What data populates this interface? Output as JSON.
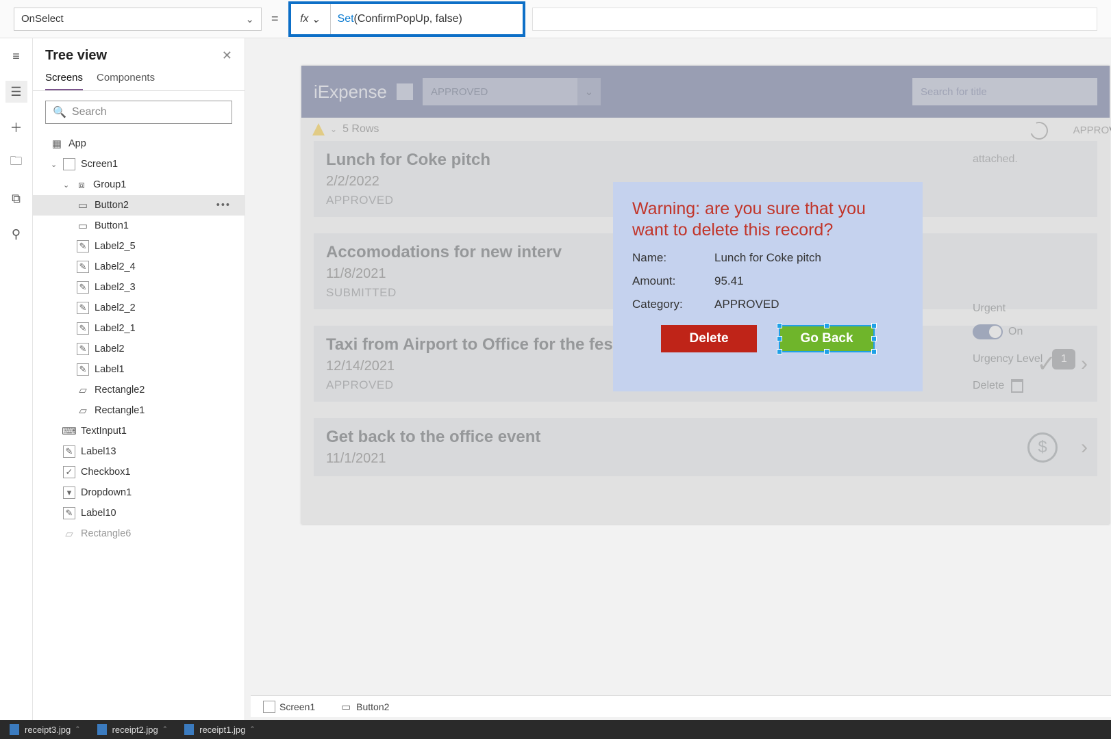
{
  "formula_bar": {
    "property": "OnSelect",
    "fx_label": "fx",
    "formula_kw": "Set",
    "formula_rest": "(ConfirmPopUp, false)"
  },
  "tree": {
    "title": "Tree view",
    "tabs": {
      "screens": "Screens",
      "components": "Components"
    },
    "search_placeholder": "Search",
    "nodes": {
      "app": "App",
      "screen1": "Screen1",
      "group1": "Group1",
      "button2": "Button2",
      "button1": "Button1",
      "label2_5": "Label2_5",
      "label2_4": "Label2_4",
      "label2_3": "Label2_3",
      "label2_2": "Label2_2",
      "label2_1": "Label2_1",
      "label2": "Label2",
      "label1": "Label1",
      "rectangle2": "Rectangle2",
      "rectangle1": "Rectangle1",
      "textinput1": "TextInput1",
      "label13": "Label13",
      "checkbox1": "Checkbox1",
      "dropdown1": "Dropdown1",
      "label10": "Label10",
      "rectangle6": "Rectangle6"
    }
  },
  "app": {
    "title": "iExpense",
    "combo_value": "APPROVED",
    "search_placeholder": "Search for title",
    "rows_label": "5 Rows",
    "approved_float": "APPROVED",
    "cards": [
      {
        "title": "Lunch for Coke pitch",
        "date": "2/2/2022",
        "status": "APPROVED"
      },
      {
        "title": "Accomodations for new interv",
        "date": "11/8/2021",
        "status": "SUBMITTED"
      },
      {
        "title": "Taxi from Airport to Office for the festival",
        "date": "12/14/2021",
        "status": "APPROVED"
      },
      {
        "title": "Get back to the office event",
        "date": "11/1/2021",
        "status": ""
      }
    ],
    "rightcol": {
      "attached": "attached.",
      "urgent_label": "Urgent",
      "urgent_state": "On",
      "urgency_label": "Urgency Level",
      "urgency_value": "1",
      "delete_label": "Delete"
    }
  },
  "popup": {
    "warning": "Warning: are you sure that you want to delete this record?",
    "name_k": "Name:",
    "name_v": "Lunch for Coke pitch",
    "amount_k": "Amount:",
    "amount_v": "95.41",
    "category_k": "Category:",
    "category_v": "APPROVED",
    "delete_btn": "Delete",
    "goback_btn": "Go Back"
  },
  "breadcrumbs": {
    "screen1": "Screen1",
    "button2": "Button2"
  },
  "taskbar": {
    "f1": "receipt3.jpg",
    "f2": "receipt2.jpg",
    "f3": "receipt1.jpg"
  }
}
